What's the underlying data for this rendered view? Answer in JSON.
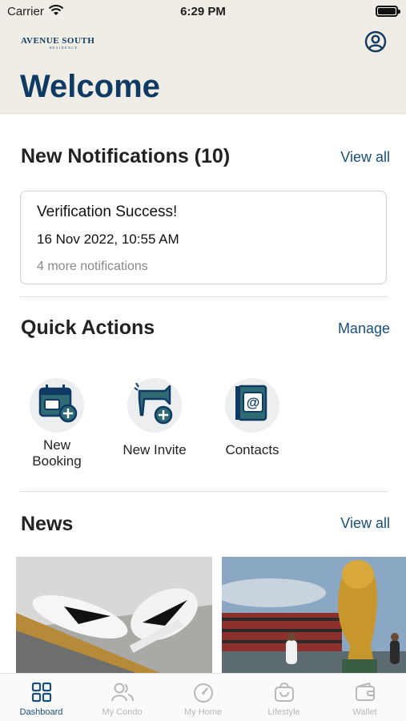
{
  "status_bar": {
    "carrier": "Carrier",
    "time": "6:29 PM"
  },
  "header": {
    "logo_line1": "AVENUE SOUTH",
    "logo_line2": "RESIDENCE",
    "title": "Welcome"
  },
  "notifications": {
    "title": "New Notifications (10)",
    "link": "View all",
    "card_title": "Verification Success!",
    "card_date": "16 Nov 2022, 10:55 AM",
    "card_more": "4 more notifications"
  },
  "quick_actions": {
    "title": "Quick Actions",
    "link": "Manage",
    "items": [
      {
        "label": "New\nBooking",
        "icon": "calendar-add-icon"
      },
      {
        "label": "New Invite",
        "icon": "megaphone-add-icon"
      },
      {
        "label": "Contacts",
        "icon": "contacts-book-icon"
      }
    ]
  },
  "news": {
    "title": "News",
    "link": "View all",
    "items": [
      {
        "image": "sneakers-photo"
      },
      {
        "image": "world-cup-trophy-photo"
      }
    ]
  },
  "tabbar": {
    "items": [
      {
        "label": "Dashboard",
        "icon": "grid-icon",
        "active": true
      },
      {
        "label": "My Condo",
        "icon": "people-icon"
      },
      {
        "label": "My Home",
        "icon": "gauge-icon"
      },
      {
        "label": "Lifestyle",
        "icon": "bag-icon"
      },
      {
        "label": "Wallet",
        "icon": "wallet-icon"
      }
    ]
  },
  "colors": {
    "primary": "#0e3a63",
    "link": "#1a4f7a",
    "header_bg": "#efede6"
  }
}
